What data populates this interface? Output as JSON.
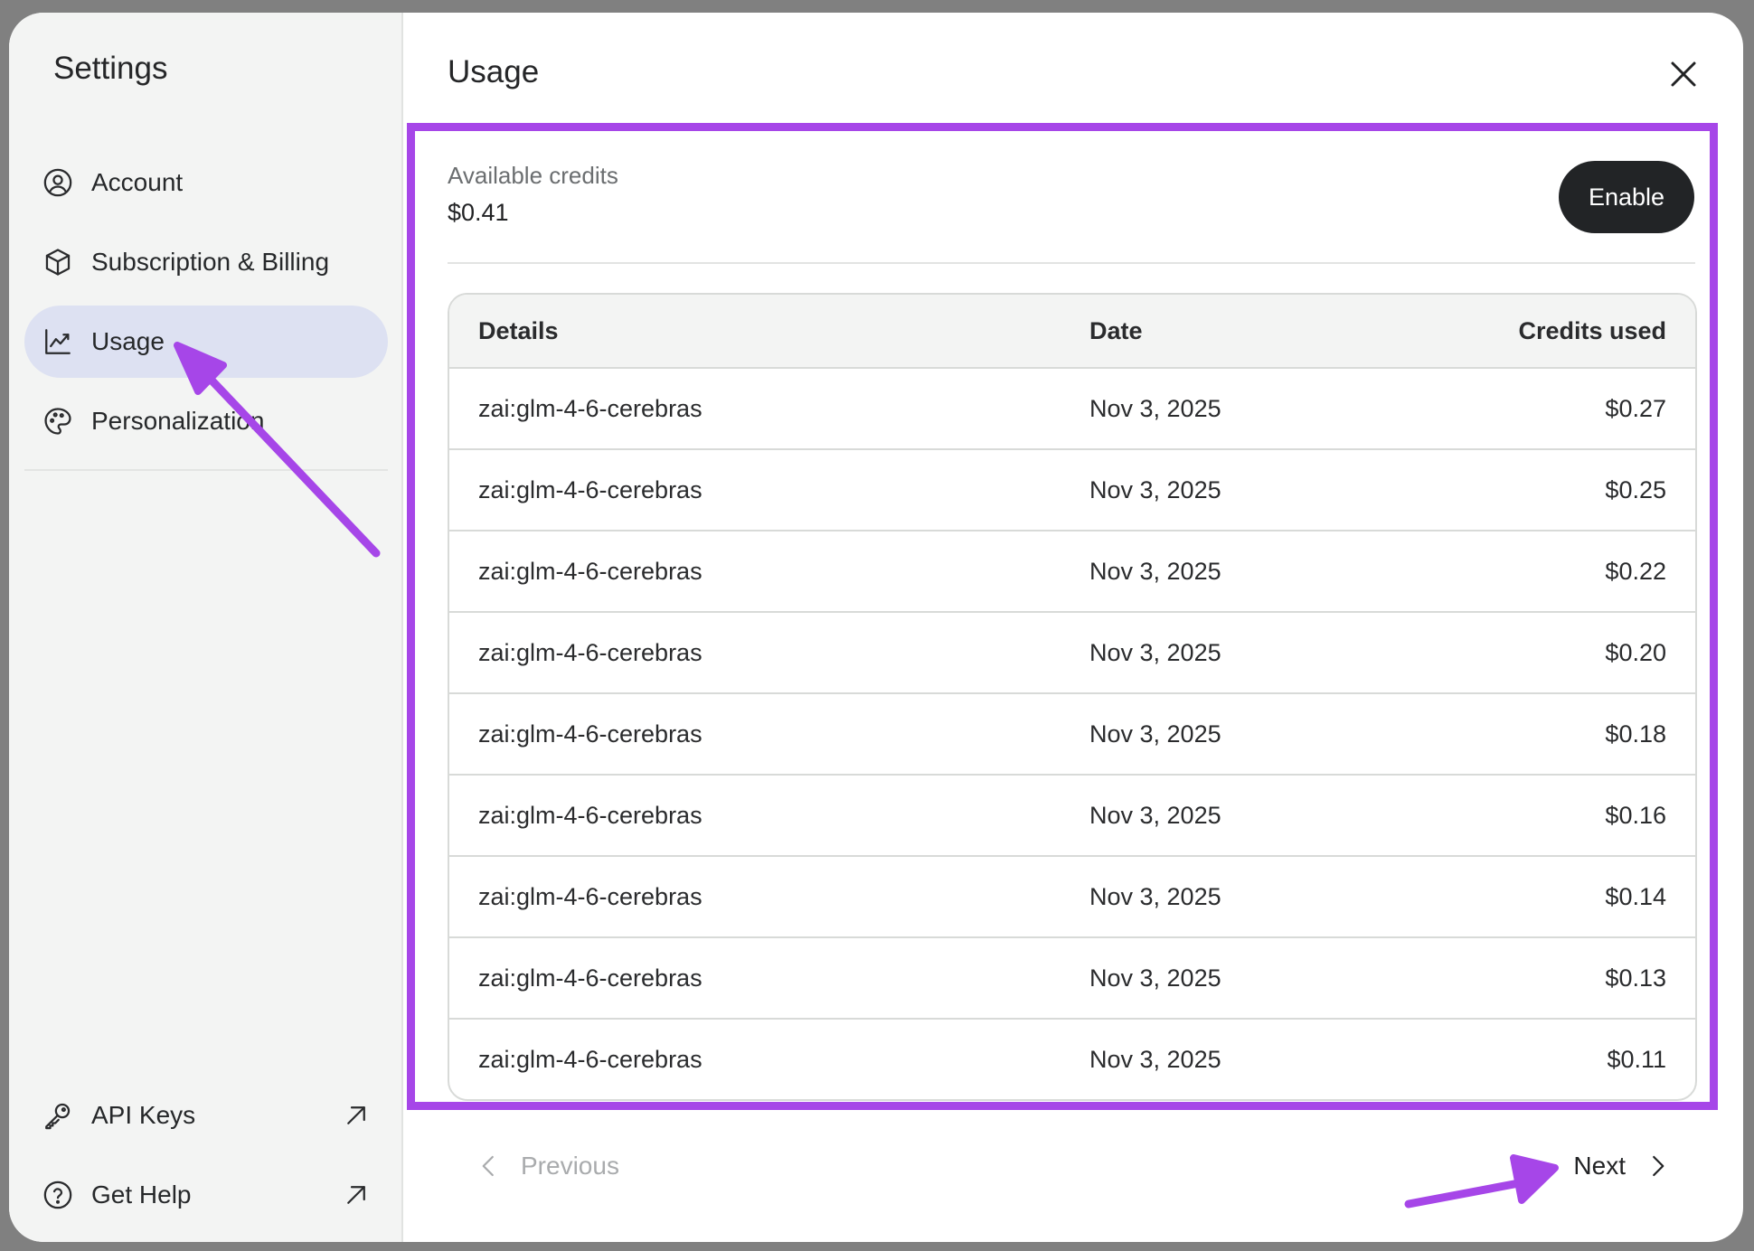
{
  "sidebar": {
    "title": "Settings",
    "items": [
      {
        "label": "Account",
        "icon": "user-circle-icon"
      },
      {
        "label": "Subscription & Billing",
        "icon": "package-icon"
      },
      {
        "label": "Usage",
        "icon": "chart-line-icon",
        "active": true
      },
      {
        "label": "Personalization",
        "icon": "palette-icon"
      }
    ],
    "bottom_items": [
      {
        "label": "API Keys",
        "icon": "key-icon",
        "external": "arrow-up-right-icon"
      },
      {
        "label": "Get Help",
        "icon": "help-circle-icon",
        "external": "arrow-up-right-icon"
      }
    ]
  },
  "main": {
    "title": "Usage",
    "credits_label": "Available credits",
    "credits_value": "$0.41",
    "enable_label": "Enable",
    "table": {
      "headers": [
        "Details",
        "Date",
        "Credits used"
      ],
      "rows": [
        {
          "details": "zai:glm-4-6-cerebras",
          "date": "Nov 3, 2025",
          "credits": "$0.27"
        },
        {
          "details": "zai:glm-4-6-cerebras",
          "date": "Nov 3, 2025",
          "credits": "$0.25"
        },
        {
          "details": "zai:glm-4-6-cerebras",
          "date": "Nov 3, 2025",
          "credits": "$0.22"
        },
        {
          "details": "zai:glm-4-6-cerebras",
          "date": "Nov 3, 2025",
          "credits": "$0.20"
        },
        {
          "details": "zai:glm-4-6-cerebras",
          "date": "Nov 3, 2025",
          "credits": "$0.18"
        },
        {
          "details": "zai:glm-4-6-cerebras",
          "date": "Nov 3, 2025",
          "credits": "$0.16"
        },
        {
          "details": "zai:glm-4-6-cerebras",
          "date": "Nov 3, 2025",
          "credits": "$0.14"
        },
        {
          "details": "zai:glm-4-6-cerebras",
          "date": "Nov 3, 2025",
          "credits": "$0.13"
        },
        {
          "details": "zai:glm-4-6-cerebras",
          "date": "Nov 3, 2025",
          "credits": "$0.11"
        }
      ]
    },
    "pagination": {
      "previous_label": "Previous",
      "next_label": "Next"
    }
  },
  "colors": {
    "annotation": "#a646e8",
    "active_nav": "#dde1f2",
    "sidebar_bg": "#f3f4f3",
    "button_dark": "#222426"
  }
}
